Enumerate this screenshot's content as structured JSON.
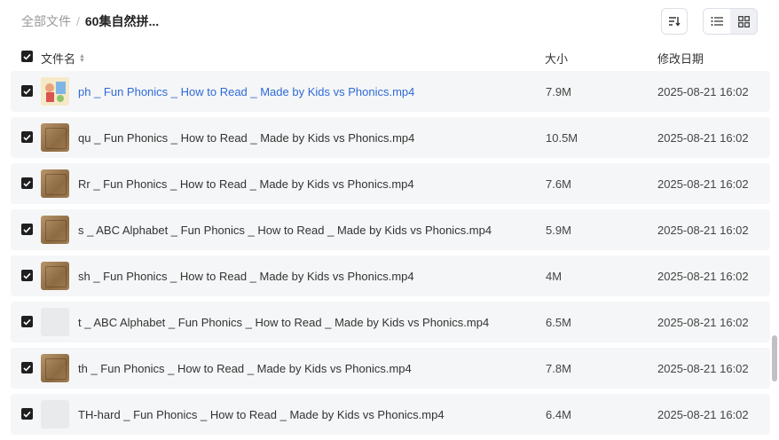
{
  "breadcrumb": {
    "root": "全部文件",
    "separator": "/",
    "current": "60集自然拼..."
  },
  "columns": {
    "name": "文件名",
    "size": "大小",
    "date": "修改日期"
  },
  "rows": [
    {
      "name": "ph _ Fun Phonics _ How to Read _ Made by Kids vs Phonics.mp4",
      "size": "7.9M",
      "date": "2025-08-21 16:02",
      "thumb": "picture",
      "highlight": true
    },
    {
      "name": "qu _ Fun Phonics _ How to Read _ Made by Kids vs Phonics.mp4",
      "size": "10.5M",
      "date": "2025-08-21 16:02",
      "thumb": "scroll"
    },
    {
      "name": "Rr _ Fun Phonics _ How to Read _ Made by Kids vs Phonics.mp4",
      "size": "7.6M",
      "date": "2025-08-21 16:02",
      "thumb": "scroll"
    },
    {
      "name": "s _ ABC Alphabet _ Fun Phonics _ How to Read _ Made by Kids vs Phonics.mp4",
      "size": "5.9M",
      "date": "2025-08-21 16:02",
      "thumb": "scroll"
    },
    {
      "name": "sh _ Fun Phonics _ How to Read _ Made by Kids vs Phonics.mp4",
      "size": "4M",
      "date": "2025-08-21 16:02",
      "thumb": "scroll"
    },
    {
      "name": "t _ ABC Alphabet _ Fun Phonics _ How to Read _ Made by Kids vs Phonics.mp4",
      "size": "6.5M",
      "date": "2025-08-21 16:02",
      "thumb": "blank"
    },
    {
      "name": "th _ Fun Phonics _ How to Read _ Made by Kids vs Phonics.mp4",
      "size": "7.8M",
      "date": "2025-08-21 16:02",
      "thumb": "scroll"
    },
    {
      "name": "TH-hard _ Fun Phonics _ How to Read _ Made by Kids vs Phonics.mp4",
      "size": "6.4M",
      "date": "2025-08-21 16:02",
      "thumb": "blank"
    }
  ],
  "colors": {
    "link": "#2f6bd8",
    "row_bg": "#f5f6f7",
    "checkbox": "#1f1f1f"
  },
  "icons": {
    "sort": "sort-list-icon",
    "list_view": "list-view-icon",
    "grid_view": "grid-view-icon",
    "checkbox": "checkmark-icon"
  }
}
